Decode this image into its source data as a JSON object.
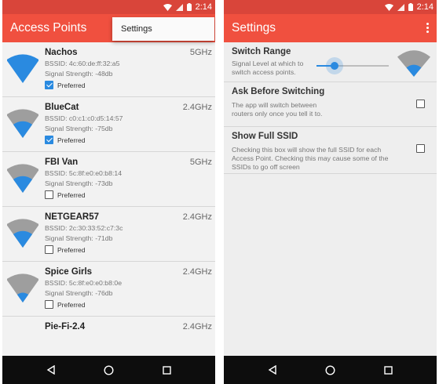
{
  "status": {
    "time": "2:14"
  },
  "left": {
    "title": "Access Points",
    "menu": {
      "item": "Settings"
    },
    "access_points": [
      {
        "name": "Nachos",
        "band": "5GHz",
        "bssid": "BSSID: 4c:60:de:ff:32:a5",
        "signal": "Signal Strength: -48db",
        "preferred_label": "Preferred",
        "preferred": true,
        "strength": 4
      },
      {
        "name": "BlueCat",
        "band": "2.4GHz",
        "bssid": "BSSID: c0:c1:c0:d5:14:57",
        "signal": "Signal Strength: -75db",
        "preferred_label": "Preferred",
        "preferred": true,
        "strength": 2
      },
      {
        "name": "FBI Van",
        "band": "5GHz",
        "bssid": "BSSID: 5c:8f:e0:e0:b8:14",
        "signal": "Signal Strength: -73db",
        "preferred_label": "Preferred",
        "preferred": false,
        "strength": 2
      },
      {
        "name": "NETGEAR57",
        "band": "2.4GHz",
        "bssid": "BSSID: 2c:30:33:52:c7:3c",
        "signal": "Signal Strength: -71db",
        "preferred_label": "Preferred",
        "preferred": false,
        "strength": 2
      },
      {
        "name": "Spice Girls",
        "band": "2.4GHz",
        "bssid": "BSSID: 5c:8f:e0:e0:b8:0e",
        "signal": "Signal Strength: -76db",
        "preferred_label": "Preferred",
        "preferred": false,
        "strength": 1
      },
      {
        "name": "Pie-Fi-2.4",
        "band": "2.4GHz",
        "bssid": "",
        "signal": "",
        "preferred_label": "",
        "preferred": false,
        "strength": 0
      }
    ]
  },
  "right": {
    "title": "Settings",
    "switch_range": {
      "title": "Switch Range",
      "desc": "Signal Level at which to switch access points.",
      "level": 0.25
    },
    "ask_before_switching": {
      "title": "Ask Before Switching",
      "desc": "The app will switch between routers only once you tell it to.",
      "checked": false
    },
    "show_full_ssid": {
      "title": "Show Full SSID",
      "desc": "Checking this box will show the full SSID for each Access Point. Checking this may cause some of the SSIDs to go off screen",
      "checked": false
    }
  },
  "colors": {
    "accent": "#f0503f",
    "status_bar": "#d9453a",
    "wifi_blue": "#2a8ae0",
    "wifi_grey": "#9e9e9e"
  },
  "icons": [
    "wifi-status-icon",
    "cell-signal-icon",
    "battery-icon",
    "overflow-menu-icon",
    "wifi-strength-icon",
    "back-icon",
    "home-icon",
    "recents-icon"
  ]
}
